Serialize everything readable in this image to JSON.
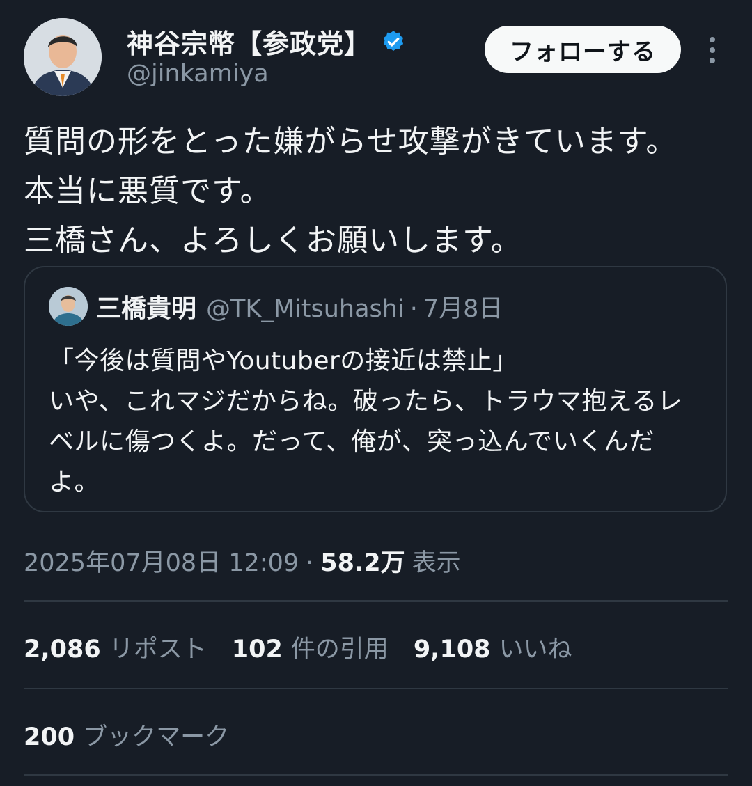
{
  "author": {
    "name": "神谷宗幣【参政党】",
    "handle": "@jinkamiya",
    "verified_color": "#1d9bf0"
  },
  "actions": {
    "follow_label": "フォローする"
  },
  "tweet": {
    "text": "質問の形をとった嫌がらせ攻撃がきています。\n本当に悪質です。\n三橋さん、よろしくお願いします。"
  },
  "quote": {
    "name": "三橋貴明",
    "handle": "@TK_Mitsuhashi",
    "dot": "·",
    "date": "7月8日",
    "text": "「今後は質問やYoutuberの接近は禁止」\nいや、これマジだからね。破ったら、トラウマ抱えるレベルに傷つくよ。だって、俺が、突っ込んでいくんだよ。"
  },
  "meta": {
    "timestamp": "2025年07月08日 12:09",
    "dot": "·",
    "views_count": "58.2万",
    "views_label": "表示"
  },
  "stats": {
    "reposts": {
      "count": "2,086",
      "label": "リポスト"
    },
    "quotes": {
      "count": "102",
      "label": "件の引用"
    },
    "likes": {
      "count": "9,108",
      "label": "いいね"
    },
    "bookmarks": {
      "count": "200",
      "label": "ブックマーク"
    }
  },
  "colors": {
    "background": "#171d26",
    "text_primary": "#f2f4f5",
    "text_secondary": "#8b98a5",
    "border": "#2f3842"
  }
}
